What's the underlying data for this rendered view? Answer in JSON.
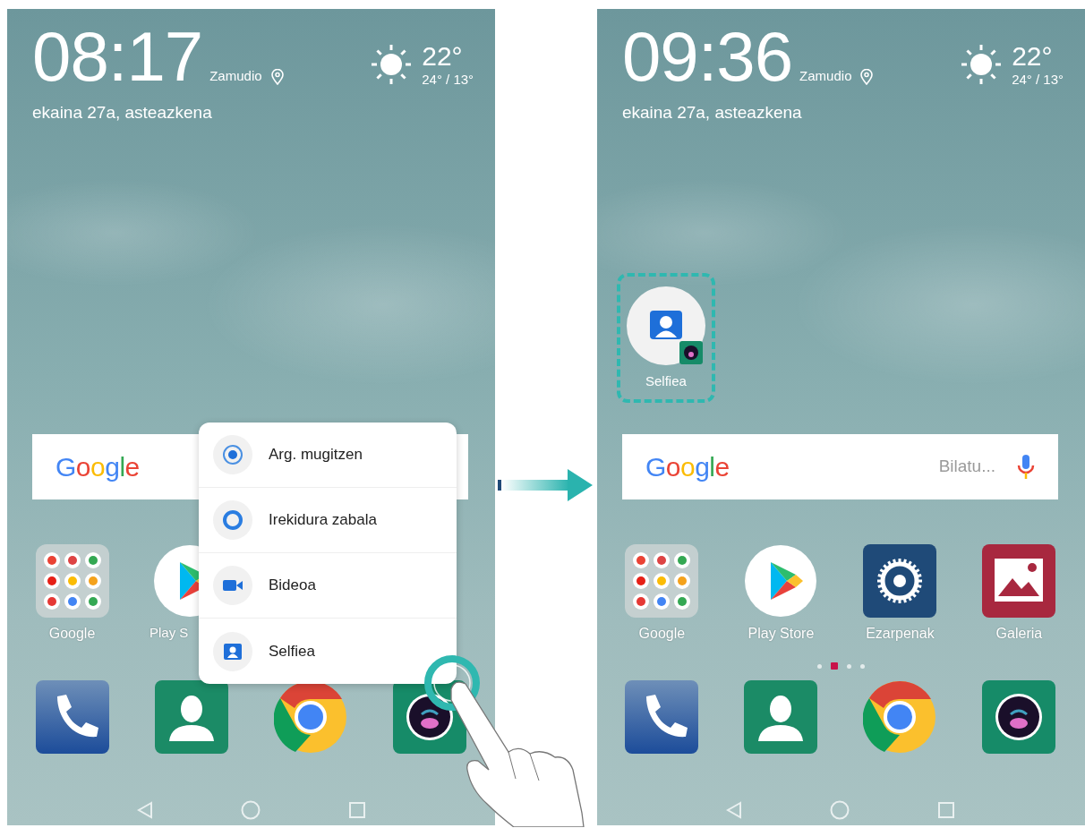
{
  "screens": [
    {
      "clock": "08:17",
      "location": "Zamudio",
      "temperature": "22°",
      "temp_range": "24° / 13°",
      "date": "ekaina 27a, asteazkena",
      "search": {
        "logo": "Google",
        "mic": false
      },
      "apps": [
        {
          "kind": "folder",
          "label": "Google",
          "cut": false
        },
        {
          "kind": "play",
          "label": "Play S",
          "cut": true
        }
      ],
      "dock": [
        {
          "kind": "phone"
        },
        {
          "kind": "contacts"
        },
        {
          "kind": "chrome"
        },
        {
          "kind": "camera"
        }
      ],
      "shortcut_menu": [
        {
          "kind": "moving",
          "label": "Arg. mugitzen"
        },
        {
          "kind": "aperture",
          "label": "Irekidura zabala"
        },
        {
          "kind": "video",
          "label": "Bideoa"
        },
        {
          "kind": "selfie",
          "label": "Selfiea"
        }
      ],
      "touch": true
    },
    {
      "clock": "09:36",
      "location": "Zamudio",
      "temperature": "22°",
      "temp_range": "24° / 13°",
      "date": "ekaina 27a, asteazkena",
      "shortcut": {
        "label": "Selfiea",
        "highlighted": true
      },
      "search": {
        "logo": "Google",
        "placeholder": "Bilatu...",
        "mic": true
      },
      "apps": [
        {
          "kind": "folder",
          "label": "Google",
          "cut": false
        },
        {
          "kind": "play",
          "label": "Play Store",
          "cut": false
        },
        {
          "kind": "settings",
          "label": "Ezarpenak",
          "cut": false
        },
        {
          "kind": "gallery",
          "label": "Galeria",
          "cut": false
        }
      ],
      "page_dots": [
        {
          "selected": false
        },
        {
          "selected": true
        },
        {
          "selected": false
        },
        {
          "selected": false
        }
      ],
      "dock": [
        {
          "kind": "phone"
        },
        {
          "kind": "contacts"
        },
        {
          "kind": "chrome"
        },
        {
          "kind": "camera"
        }
      ],
      "touch": false
    }
  ]
}
